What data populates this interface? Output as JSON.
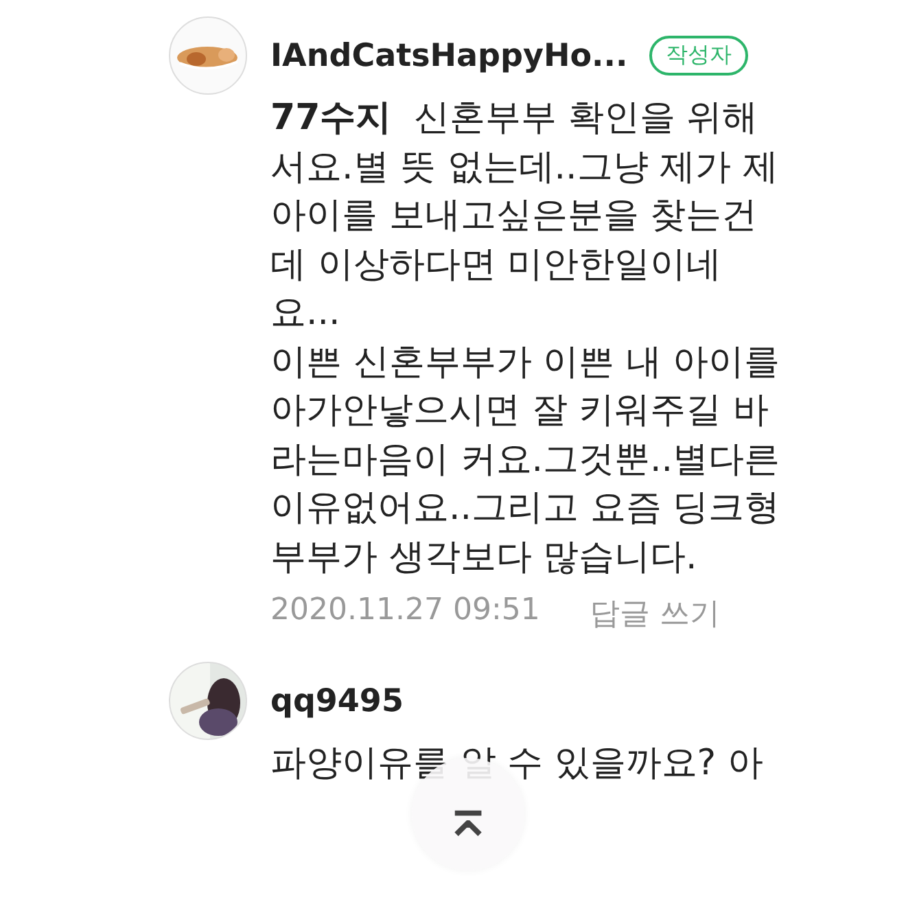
{
  "comments": [
    {
      "author": "IAndCatsHappyHo...",
      "badge": "작성자",
      "text": "**77수지**  신혼부부 확인을 위해서요.별 뜻 없는데..그냥 제가 제 아이를 보내고싶은분을 찾는건데 이상하다면 미안한일이네요...\n이쁜 신혼부부가 이쁜 내 아이를 아가안낳으시면 잘 키워주길 바라는마음이 커요.그것뿐..별다른 이유없어요..그리고 요즘 딩크형부부가 생각보다 많습니다.",
      "date": "2020.11.27 09:51",
      "reply": "답글 쓰기"
    },
    {
      "author": "qq9495",
      "text": "파양이유를 알 수 있을까요? 아"
    }
  ],
  "scroll_top_button": {
    "icon": "⌅"
  }
}
